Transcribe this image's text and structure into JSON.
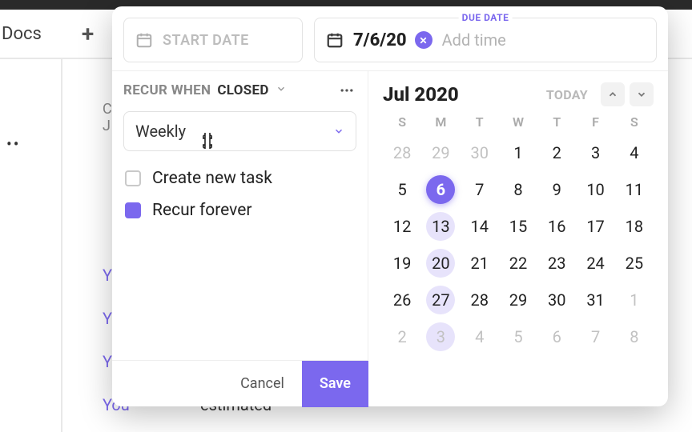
{
  "colors": {
    "accent": "#7b68ee"
  },
  "background": {
    "docs_label": "Docs",
    "plus_label": "+",
    "crumb_line1": "C",
    "crumb_line2": "J",
    "you": "Yo",
    "you_full": "You",
    "estimated": "estimated"
  },
  "date": {
    "start_placeholder": "START DATE",
    "due_label": "DUE DATE",
    "due_value": "7/6/20",
    "add_time": "Add time"
  },
  "recur": {
    "prefix": "RECUR WHEN",
    "state": "CLOSED",
    "frequency": "Weekly",
    "options": {
      "create_new_task": {
        "label": "Create new task",
        "checked": false
      },
      "recur_forever": {
        "label": "Recur forever",
        "checked": true
      }
    }
  },
  "calendar": {
    "month_label": "Jul 2020",
    "today_label": "TODAY",
    "dow": [
      "S",
      "M",
      "T",
      "W",
      "T",
      "F",
      "S"
    ],
    "weeks": [
      [
        {
          "d": 28,
          "other": true
        },
        {
          "d": 29,
          "other": true
        },
        {
          "d": 30,
          "other": true
        },
        {
          "d": 1
        },
        {
          "d": 2
        },
        {
          "d": 3
        },
        {
          "d": 4
        }
      ],
      [
        {
          "d": 5
        },
        {
          "d": 6,
          "selected": true
        },
        {
          "d": 7
        },
        {
          "d": 8
        },
        {
          "d": 9
        },
        {
          "d": 10
        },
        {
          "d": 11
        }
      ],
      [
        {
          "d": 12
        },
        {
          "d": 13,
          "hl": true
        },
        {
          "d": 14
        },
        {
          "d": 15
        },
        {
          "d": 16
        },
        {
          "d": 17
        },
        {
          "d": 18
        }
      ],
      [
        {
          "d": 19
        },
        {
          "d": 20,
          "hl": true
        },
        {
          "d": 21
        },
        {
          "d": 22
        },
        {
          "d": 23
        },
        {
          "d": 24
        },
        {
          "d": 25
        }
      ],
      [
        {
          "d": 26
        },
        {
          "d": 27,
          "hl": true
        },
        {
          "d": 28
        },
        {
          "d": 29
        },
        {
          "d": 30
        },
        {
          "d": 31
        },
        {
          "d": 1,
          "other": true
        }
      ],
      [
        {
          "d": 2,
          "other": true
        },
        {
          "d": 3,
          "other": true,
          "hl": true
        },
        {
          "d": 4,
          "other": true
        },
        {
          "d": 5,
          "other": true
        },
        {
          "d": 6,
          "other": true
        },
        {
          "d": 7,
          "other": true
        },
        {
          "d": 8,
          "other": true
        }
      ]
    ]
  },
  "footer": {
    "cancel": "Cancel",
    "save": "Save"
  }
}
